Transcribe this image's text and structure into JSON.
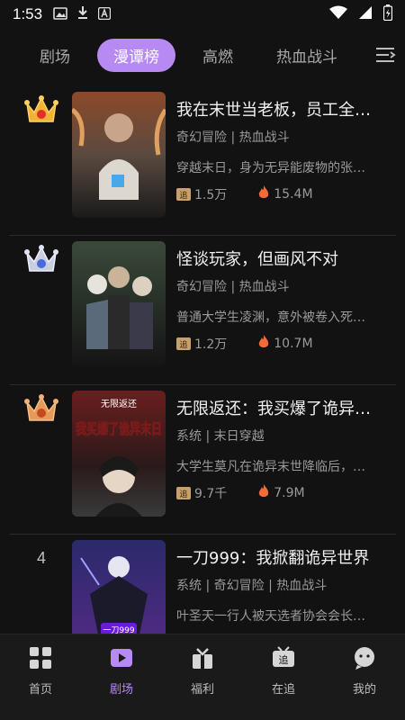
{
  "status_bar": {
    "time": "1:53"
  },
  "tabs": [
    {
      "label": "剧场",
      "active": false
    },
    {
      "label": "漫谭榜",
      "active": true
    },
    {
      "label": "高燃",
      "active": false
    },
    {
      "label": "热血战斗",
      "active": false
    }
  ],
  "items": [
    {
      "rank": "1",
      "rank_type": "gold-crown",
      "title": "我在末世当老板，员工全…",
      "tags": "奇幻冒险 | 热血战斗",
      "desc": "穿越末日，身为无异能废物的张…",
      "follows": "1.5万",
      "heat": "15.4M"
    },
    {
      "rank": "2",
      "rank_type": "silver-crown",
      "title": "怪谈玩家，但画风不对",
      "tags": "奇幻冒险 | 热血战斗",
      "desc": "普通大学生凌渊，意外被卷入死…",
      "follows": "1.2万",
      "heat": "10.7M"
    },
    {
      "rank": "3",
      "rank_type": "bronze-crown",
      "title": "无限返还：我买爆了诡异…",
      "tags": "系统 | 末日穿越",
      "desc": "大学生莫凡在诡异末世降临后，…",
      "follows": "9.7千",
      "heat": "7.9M",
      "cover_text_top": "无限返还",
      "cover_text_main": "我买爆了诡异末日"
    },
    {
      "rank": "4",
      "rank_type": "number",
      "title": "一刀999：我掀翻诡异世界",
      "tags": "系统 | 奇幻冒险 | 热血战斗",
      "desc": "叶圣天一行人被天选者协会会长…",
      "follows": "",
      "heat": "",
      "cover_text_main": "一刀999"
    }
  ],
  "follow_badge": "追",
  "nav": [
    {
      "label": "首页",
      "icon": "home-grid-icon",
      "active": false
    },
    {
      "label": "剧场",
      "icon": "theater-play-icon",
      "active": true
    },
    {
      "label": "福利",
      "icon": "gift-icon",
      "active": false
    },
    {
      "label": "在追",
      "icon": "follow-tv-icon",
      "active": false
    },
    {
      "label": "我的",
      "icon": "profile-chat-icon",
      "active": false
    }
  ],
  "colors": {
    "accent": "#b68af2",
    "background": "#121212",
    "gold": "#f2b233",
    "silver": "#c9cfe0",
    "bronze": "#e59a5a",
    "flame": "#f46b3a"
  }
}
